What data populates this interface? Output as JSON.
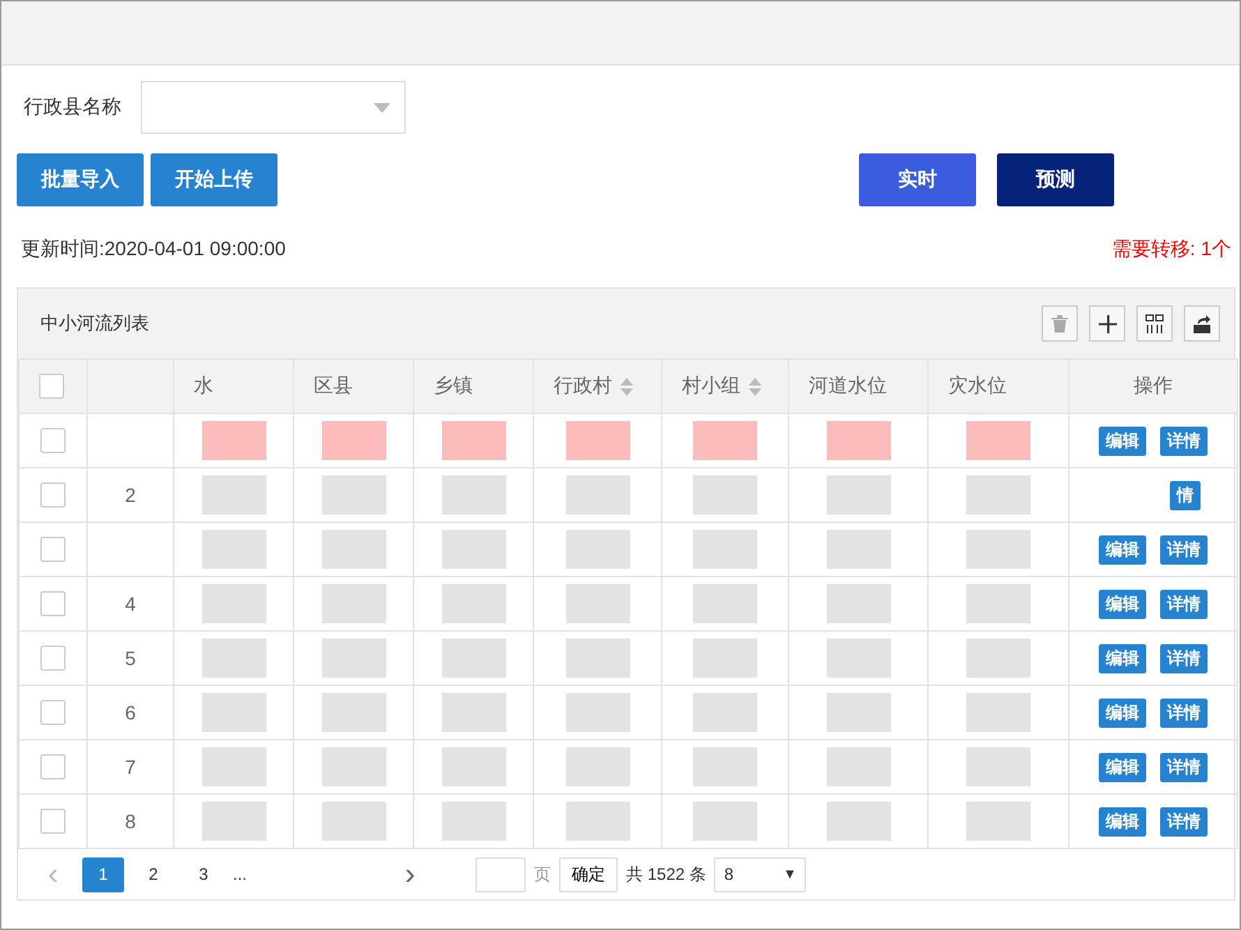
{
  "filter": {
    "label": "行政县名称"
  },
  "buttons": [
    {
      "label": "批量导入",
      "kind": "primary"
    },
    {
      "label": "开始上传",
      "kind": "primary"
    },
    {
      "label": "实时",
      "kind": "realtime"
    },
    {
      "label": "预测",
      "kind": "forecast"
    }
  ],
  "update_time": "更新时间:2020-04-01 09:00:00",
  "transfer_notice": "需要转移: 1个",
  "table": {
    "title": "中小河流列表",
    "select_all_checked": false,
    "columns": [
      {
        "label": "水",
        "sortable": false
      },
      {
        "label": "区县",
        "sortable": false
      },
      {
        "label": "乡镇",
        "sortable": false
      },
      {
        "label": "行政村",
        "sortable": true
      },
      {
        "label": "村小组",
        "sortable": true
      },
      {
        "label": "河道水位",
        "sortable": false
      },
      {
        "label": "灾水位",
        "sortable": false
      },
      {
        "label": "操作",
        "sortable": false
      }
    ],
    "rows": [
      {
        "checked": false,
        "highlighted": true,
        "actions": [
          "编辑",
          "详情"
        ]
      },
      {
        "index": "2",
        "checked": false,
        "highlighted": false,
        "actions": [
          "情"
        ]
      },
      {
        "checked": false,
        "highlighted": false,
        "actions": [
          "编辑",
          "详情"
        ]
      },
      {
        "index": "4",
        "checked": false,
        "highlighted": false,
        "actions": [
          "编辑",
          "详情"
        ]
      },
      {
        "index": "5",
        "checked": false,
        "highlighted": false,
        "actions": [
          "编辑",
          "详情"
        ]
      },
      {
        "index": "6",
        "checked": false,
        "highlighted": false,
        "actions": [
          "编辑",
          "详情"
        ]
      },
      {
        "index": "7",
        "checked": false,
        "highlighted": false,
        "actions": [
          "编辑",
          "详情"
        ]
      },
      {
        "index": "8",
        "checked": false,
        "highlighted": false,
        "actions": [
          "编辑",
          "详情"
        ]
      }
    ]
  },
  "pagination": {
    "prev": "‹",
    "pages": [
      {
        "label": "1",
        "selected": true
      },
      {
        "label": "2",
        "selected": false
      },
      {
        "label": "3",
        "selected": false
      }
    ],
    "ellipsis": "...",
    "next": "›",
    "page_unit": "页",
    "confirm": "确定",
    "total": "共 1522 条",
    "page_size": "8",
    "caret": "▼"
  }
}
